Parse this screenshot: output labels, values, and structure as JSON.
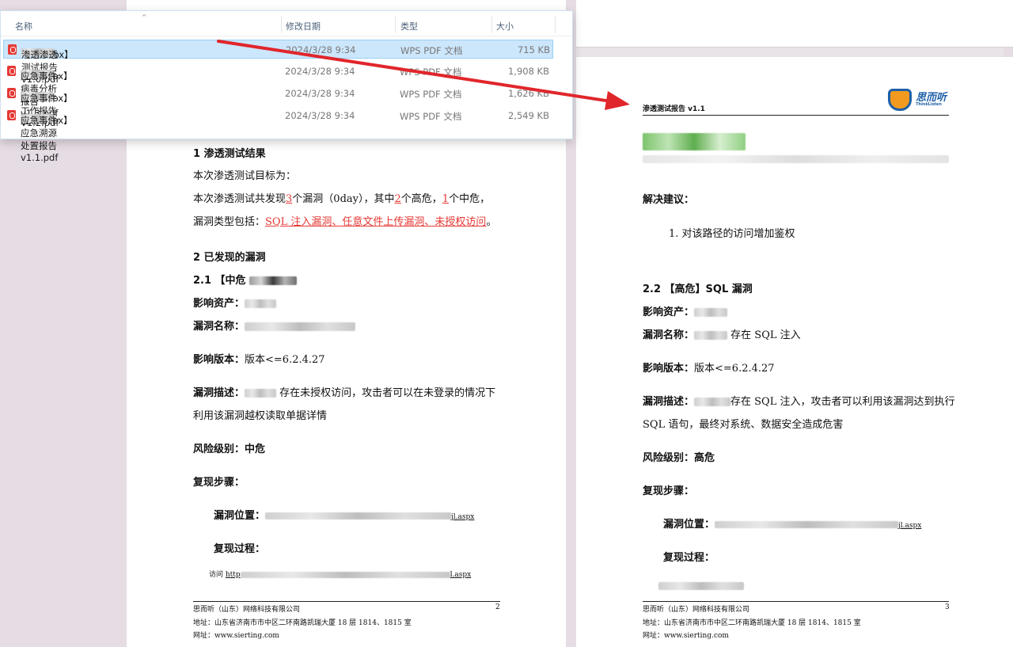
{
  "explorer": {
    "columns": {
      "name": "名称",
      "date": "修改日期",
      "type": "类型",
      "size": "大小"
    },
    "files": [
      {
        "prefix": "【rmallox】",
        "suffix": "渗透渗透测试报告v1.0.pdf",
        "date": "2024/3/28 9:34",
        "type": "WPS PDF 文档",
        "size": "715 KB"
      },
      {
        "prefix": "【rmallox】",
        "suffix": "应急事件病毒分析报告v1.3.pdf",
        "date": "2024/3/28 9:34",
        "type": "WPS PDF 文档",
        "size": "1,908 KB"
      },
      {
        "prefix": "【rmallox】",
        "suffix": "应急事件工作报告V1.2.pdf",
        "date": "2024/3/28 9:34",
        "type": "WPS PDF 文档",
        "size": "1,626 KB"
      },
      {
        "prefix": "【rmallox】",
        "suffix": "应急事件应急溯源处置报告v1.1.pdf",
        "date": "2024/3/28 9:34",
        "type": "WPS PDF 文档",
        "size": "2,549 KB"
      }
    ]
  },
  "left_page": {
    "sec1": "1 渗透测试结果",
    "goal": "本次渗透测试目标为：",
    "summary_a": "本次渗透测试共发现",
    "n_vulns": "3",
    "summary_b": "个漏洞（0day），其中",
    "n_high": "2",
    "summary_c": "个高危，",
    "n_mid": "1",
    "summary_d": "个中危，",
    "types_label": "漏洞类型包括：",
    "types_value": "SQL 注入漏洞、任意文件上传漏洞、未授权访问",
    "types_end": "。",
    "sec2": "2 已发现的漏洞",
    "sub21": "2.1 【中危",
    "asset_label": "影响资产：",
    "name_label": "漏洞名称：",
    "version_label": "影响版本：",
    "version_value": "版本<=6.2.4.27",
    "desc_label": "漏洞描述：",
    "desc_value": "存在未授权访问，攻击者可以在未登录的情况下",
    "desc_value2": "利用该漏洞越权读取单据详情",
    "risk_label": "风险级别：",
    "risk_value": "中危",
    "steps_label": "复现步骤：",
    "loc_label": "漏洞位置：",
    "loc_tail": "jl.aspx",
    "proc_label": "复现过程：",
    "visit_prefix": "访问",
    "visit_url_head": "http",
    "visit_url_tail": "l.aspx",
    "footer_company": "思而听（山东）网络科技有限公司",
    "footer_page": "2",
    "footer_addr": "地址：山东省济南市市中区二环南路凯瑞大厦 18 层 1814、1815 室",
    "footer_web": "网址：www.sierting.com"
  },
  "right_page": {
    "header_title": "渗透测试报告 v1.1",
    "logo_text": "思而听",
    "logo_sub": "ThinkListen",
    "fix_label": "解决建议：",
    "fix_item": "1. 对该路径的访问增加鉴权",
    "sub22": "2.2 【高危】SQL 漏洞",
    "asset_label": "影响资产：",
    "name_label": "漏洞名称：",
    "name_value": "存在 SQL 注入",
    "version_label": "影响版本：",
    "version_value": "版本<=6.2.4.27",
    "desc_label": "漏洞描述：",
    "desc_value": "存在 SQL 注入，攻击者可以利用该漏洞达到执行",
    "desc_value2": "SQL 语句，最终对系统、数据安全造成危害",
    "risk_label": "风险级别：",
    "risk_value": "高危",
    "steps_label": "复现步骤：",
    "loc_label": "漏洞位置：",
    "loc_tail": "jl.aspx",
    "proc_label": "复现过程：",
    "footer_company": "思而听（山东）网络科技有限公司",
    "footer_page": "3",
    "footer_addr": "地址：山东省济南市市中区二环南路凯瑞大厦 18 层 1814、1815 室",
    "footer_web": "网址：www.sierting.com"
  },
  "colors": {
    "accent_red": "#e53935",
    "selection": "#cce6fb",
    "logo_blue": "#1e5fa8",
    "logo_orange": "#f29a1f"
  }
}
